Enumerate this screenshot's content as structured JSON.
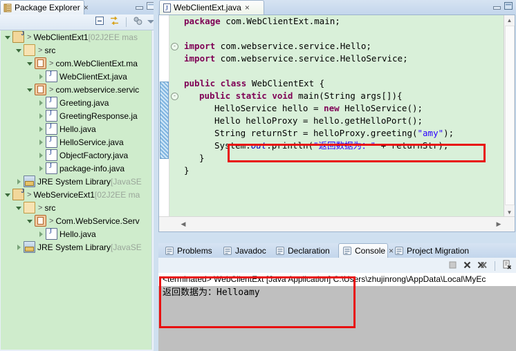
{
  "explorer": {
    "tab_label": "Package Explorer",
    "tab_close": "×",
    "icons": {
      "view_icon": "package-explorer-icon",
      "minimize": "minimize-icon",
      "maximize": "maximize-icon"
    },
    "toolbar": {
      "collapse_all": "collapse-all-icon",
      "link_with_editor": "link-with-editor-icon",
      "view_menu_filters": "filters-icon",
      "view_menu": "view-menu-icon"
    },
    "tree": [
      {
        "indent": 0,
        "arrow": "open",
        "icon": "java-project-icon",
        "chevron": ">",
        "label": "WebClientExt1",
        "dim": "[02J2EE mas"
      },
      {
        "indent": 1,
        "arrow": "open",
        "icon": "source-folder-icon",
        "chevron": ">",
        "label": "src",
        "dim": ""
      },
      {
        "indent": 2,
        "arrow": "open",
        "icon": "package-icon",
        "chevron": ">",
        "label": "com.WebClientExt.ma",
        "dim": ""
      },
      {
        "indent": 3,
        "arrow": "closed",
        "icon": "java-file-icon",
        "chevron": "",
        "label": "WebClientExt.java",
        "dim": ""
      },
      {
        "indent": 2,
        "arrow": "open",
        "icon": "package-icon",
        "chevron": ">",
        "label": "com.webservice.servic",
        "dim": ""
      },
      {
        "indent": 3,
        "arrow": "closed",
        "icon": "java-file-icon",
        "chevron": "",
        "label": "Greeting.java",
        "dim": ""
      },
      {
        "indent": 3,
        "arrow": "closed",
        "icon": "java-file-icon",
        "chevron": "",
        "label": "GreetingResponse.ja",
        "dim": ""
      },
      {
        "indent": 3,
        "arrow": "closed",
        "icon": "java-file-icon",
        "chevron": "",
        "label": "Hello.java",
        "dim": ""
      },
      {
        "indent": 3,
        "arrow": "closed",
        "icon": "java-file-icon",
        "chevron": "",
        "label": "HelloService.java",
        "dim": ""
      },
      {
        "indent": 3,
        "arrow": "closed",
        "icon": "java-file-icon",
        "chevron": "",
        "label": "ObjectFactory.java",
        "dim": ""
      },
      {
        "indent": 3,
        "arrow": "closed",
        "icon": "java-file-icon",
        "chevron": "",
        "label": "package-info.java",
        "dim": ""
      },
      {
        "indent": 1,
        "arrow": "closed",
        "icon": "jre-library-icon",
        "chevron": "",
        "label": "JRE System Library",
        "dim": "[JavaSE"
      },
      {
        "indent": 0,
        "arrow": "open",
        "icon": "java-project-icon",
        "chevron": ">",
        "label": "WebServiceExt1",
        "dim": "[02J2EE ma"
      },
      {
        "indent": 1,
        "arrow": "open",
        "icon": "source-folder-icon",
        "chevron": ">",
        "label": "src",
        "dim": ""
      },
      {
        "indent": 2,
        "arrow": "open",
        "icon": "package-icon",
        "chevron": ">",
        "label": "Com.WebService.Serv",
        "dim": ""
      },
      {
        "indent": 3,
        "arrow": "closed",
        "icon": "java-file-icon",
        "chevron": "",
        "label": "Hello.java",
        "dim": ""
      },
      {
        "indent": 1,
        "arrow": "closed",
        "icon": "jre-library-icon",
        "chevron": "",
        "label": "JRE System Library",
        "dim": "[JavaSE"
      }
    ]
  },
  "editor": {
    "tab_label": "WebClientExt.java",
    "tab_close": "×",
    "icons": {
      "minimize": "minimize-icon",
      "maximize": "maximize-icon"
    },
    "code_lines": [
      {
        "id": "l1",
        "fold": "",
        "segs": [
          {
            "t": "kw",
            "v": "package"
          },
          {
            "t": "pl",
            "v": " com.WebClientExt.main;"
          }
        ],
        "indent": 0
      },
      {
        "id": "l2",
        "fold": "",
        "segs": [],
        "indent": 0
      },
      {
        "id": "l3",
        "fold": "-",
        "segs": [
          {
            "t": "kw",
            "v": "import"
          },
          {
            "t": "pl",
            "v": " com.webservice.service.Hello;"
          }
        ],
        "indent": 0
      },
      {
        "id": "l4",
        "fold": "",
        "segs": [
          {
            "t": "kw",
            "v": "import"
          },
          {
            "t": "pl",
            "v": " com.webservice.service.HelloService;"
          }
        ],
        "indent": 0
      },
      {
        "id": "l5",
        "fold": "",
        "segs": [],
        "indent": 0
      },
      {
        "id": "l6",
        "fold": "",
        "segs": [
          {
            "t": "kw",
            "v": "public class"
          },
          {
            "t": "pl",
            "v": " WebClientExt {"
          }
        ],
        "indent": 0
      },
      {
        "id": "l7",
        "fold": "-",
        "segs": [
          {
            "t": "kw",
            "v": "public static void"
          },
          {
            "t": "pl",
            "v": " main(String args[]){"
          }
        ],
        "indent": 1
      },
      {
        "id": "l8",
        "fold": "",
        "segs": [
          {
            "t": "pl",
            "v": "HelloService hello = "
          },
          {
            "t": "kw",
            "v": "new"
          },
          {
            "t": "pl",
            "v": " HelloService();"
          }
        ],
        "indent": 2
      },
      {
        "id": "l9",
        "fold": "",
        "segs": [
          {
            "t": "pl",
            "v": "Hello helloProxy = hello.getHelloPort();"
          }
        ],
        "indent": 2
      },
      {
        "id": "l10",
        "fold": "",
        "segs": [
          {
            "t": "pl",
            "v": "String returnStr = helloProxy.greeting("
          },
          {
            "t": "str",
            "v": "\"amy\""
          },
          {
            "t": "pl",
            "v": ");"
          }
        ],
        "indent": 2
      },
      {
        "id": "l11",
        "fold": "",
        "segs": [
          {
            "t": "pl",
            "v": "System."
          },
          {
            "t": "it",
            "v": "out"
          },
          {
            "t": "pl",
            "v": ".println("
          },
          {
            "t": "str",
            "v": "\"返回数据为：\""
          },
          {
            "t": "pl",
            "v": " + returnStr);"
          }
        ],
        "indent": 2
      },
      {
        "id": "l12",
        "fold": "",
        "segs": [
          {
            "t": "pl",
            "v": "}"
          }
        ],
        "indent": 1
      },
      {
        "id": "l13",
        "fold": "",
        "segs": [
          {
            "t": "pl",
            "v": "}"
          }
        ],
        "indent": 0
      }
    ],
    "scroll": {
      "up_arrow": "▲",
      "down_arrow": "▼",
      "left_arrow": "◀",
      "right_arrow": "▶"
    }
  },
  "console_view": {
    "tabs": [
      {
        "label": "Problems",
        "icon": "problems-icon",
        "active": false
      },
      {
        "label": "Javadoc",
        "icon": "javadoc-icon",
        "active": false
      },
      {
        "label": "Declaration",
        "icon": "declaration-icon",
        "active": false
      },
      {
        "label": "Console",
        "icon": "console-icon",
        "active": true
      },
      {
        "label": "Project Migration",
        "icon": "project-migration-icon",
        "active": false
      }
    ],
    "console_close": "×",
    "toolbar": {
      "terminate": "terminate-icon",
      "remove_launch": "remove-launch-icon",
      "remove_all_terminated": "remove-all-terminated-icon",
      "clear_console": "clear-console-icon"
    },
    "header_line": "<terminated> WebClientExt [Java Application] C:\\Users\\zhujinrong\\AppData\\Local\\MyEc",
    "output_lines": [
      "返回数据为：Helloamy"
    ]
  },
  "annotations": {
    "code_highlight": {
      "name": "println-line-highlight",
      "color": "#e81010"
    },
    "console_highlight": {
      "name": "console-output-highlight",
      "color": "#e81010"
    }
  },
  "colors": {
    "tree_background": "#cfeccc",
    "code_background": "#d9f0d9",
    "console_background": "#bfbfbf",
    "chrome": "#cfe0f0",
    "keyword": "#7f0055",
    "string": "#2a00ff",
    "annotation_red": "#e81010"
  }
}
